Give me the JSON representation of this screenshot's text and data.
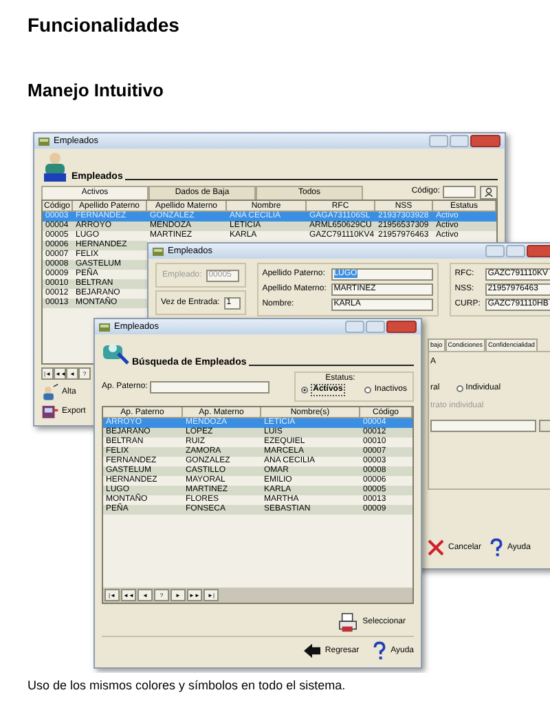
{
  "page_title": "Funcionalidades",
  "section_title": "Manejo Intuitivo",
  "list_window": {
    "title": "Empleados",
    "heading": "Empleados",
    "tabs": [
      {
        "label": "Activos",
        "selected": true
      },
      {
        "label": "Dados de Baja",
        "selected": false
      },
      {
        "label": "Todos",
        "selected": false
      }
    ],
    "code_label": "Código:",
    "columns": [
      "Código",
      "Apellido Paterno",
      "Apellido Materno",
      "Nombre",
      "RFC",
      "NSS",
      "Estatus"
    ],
    "rows": [
      {
        "cells": [
          "00003",
          "FERNANDEZ",
          "GONZALEZ",
          "ANA CECILIA",
          "GAGA731106SL",
          "21937303928",
          "Activo"
        ],
        "selected": true
      },
      {
        "cells": [
          "00004",
          "ARROYO",
          "MENDOZA",
          "LETICIA",
          "ARML650629CU",
          "21956537309",
          "Activo"
        ],
        "selected": false
      },
      {
        "cells": [
          "00005",
          "LUGO",
          "MARTINEZ",
          "KARLA",
          "GAZC791110KV4",
          "21957976463",
          "Activo"
        ],
        "selected": false
      },
      {
        "cells": [
          "00006",
          "HERNANDEZ"
        ],
        "selected": false
      },
      {
        "cells": [
          "00007",
          "FELIX"
        ],
        "selected": false
      },
      {
        "cells": [
          "00008",
          "GASTELUM"
        ],
        "selected": false
      },
      {
        "cells": [
          "00009",
          "PEÑA"
        ],
        "selected": false
      },
      {
        "cells": [
          "00010",
          "BELTRAN"
        ],
        "selected": false
      },
      {
        "cells": [
          "00012",
          "BEJARANO"
        ],
        "selected": false
      },
      {
        "cells": [
          "00013",
          "MONTAÑO"
        ],
        "selected": false
      }
    ],
    "nav": [
      "|◄",
      "◄◄",
      "◄",
      "?"
    ],
    "buttons": [
      "Alta",
      "Export"
    ]
  },
  "form_window": {
    "title": "Empleados",
    "employee_label": "Empleado:",
    "employee_value": "00005",
    "employee_disabled": true,
    "entry_label": "Vez de Entrada:",
    "entry_value": "1",
    "fields": [
      {
        "label": "Apellido Paterno:",
        "value": "LUGO",
        "selected": true
      },
      {
        "label": "Apellido Materno:",
        "value": "MARTINEZ",
        "selected": false
      },
      {
        "label": "Nombre:",
        "value": "KARLA",
        "selected": false
      }
    ],
    "ids": [
      {
        "label": "RFC:",
        "value": "GAZC791110KV"
      },
      {
        "label": "NSS:",
        "value": "21957976463"
      },
      {
        "label": "CURP:",
        "value": "GAZC791110HB"
      }
    ],
    "tabs": [
      "bajo",
      "Condiciones",
      "Confidencialidad"
    ],
    "fragment": "A",
    "radio_fragment": "ral",
    "radio": {
      "label": "Individual",
      "selected": false
    },
    "contract_label": "trato individual",
    "cancel_button": "Cancelar",
    "help_button": "Ayuda"
  },
  "search_window": {
    "title": "Empleados",
    "heading": "Búsqueda de Empleados",
    "surname_label": "Ap. Paterno:",
    "status_label": "Estatus:",
    "status_options": [
      {
        "label": "Activos",
        "selected": true
      },
      {
        "label": "Inactivos",
        "selected": false
      }
    ],
    "columns": [
      "Ap. Paterno",
      "Ap. Materno",
      "Nombre(s)",
      "Código"
    ],
    "rows": [
      {
        "cells": [
          "ARROYO",
          "MENDOZA",
          "LETICIA",
          "00004"
        ],
        "selected": true
      },
      {
        "cells": [
          "BEJARANO",
          "LOPEZ",
          "LUIS",
          "00012"
        ],
        "selected": false
      },
      {
        "cells": [
          "BELTRAN",
          "RUIZ",
          "EZEQUIEL",
          "00010"
        ],
        "selected": false
      },
      {
        "cells": [
          "FELIX",
          "ZAMORA",
          "MARCELA",
          "00007"
        ],
        "selected": false
      },
      {
        "cells": [
          "FERNANDEZ",
          "GONZALEZ",
          "ANA CECILIA",
          "00003"
        ],
        "selected": false
      },
      {
        "cells": [
          "GASTELUM",
          "CASTILLO",
          "OMAR",
          "00008"
        ],
        "selected": false
      },
      {
        "cells": [
          "HERNANDEZ",
          "MAYORAL",
          "EMILIO",
          "00006"
        ],
        "selected": false
      },
      {
        "cells": [
          "LUGO",
          "MARTINEZ",
          "KARLA",
          "00005"
        ],
        "selected": false
      },
      {
        "cells": [
          "MONTAÑO",
          "FLORES",
          "MARTHA",
          "00013"
        ],
        "selected": false
      },
      {
        "cells": [
          "PEÑA",
          "FONSECA",
          "SEBASTIAN",
          "00009"
        ],
        "selected": false
      }
    ],
    "nav": [
      "|◄",
      "◄◄",
      "◄",
      "?",
      "►",
      "►►",
      "►|"
    ],
    "select_button": "Seleccionar",
    "back_button": "Regresar",
    "help_button": "Ayuda"
  },
  "caption": "Uso de los mismos colores y símbolos en todo el sistema."
}
